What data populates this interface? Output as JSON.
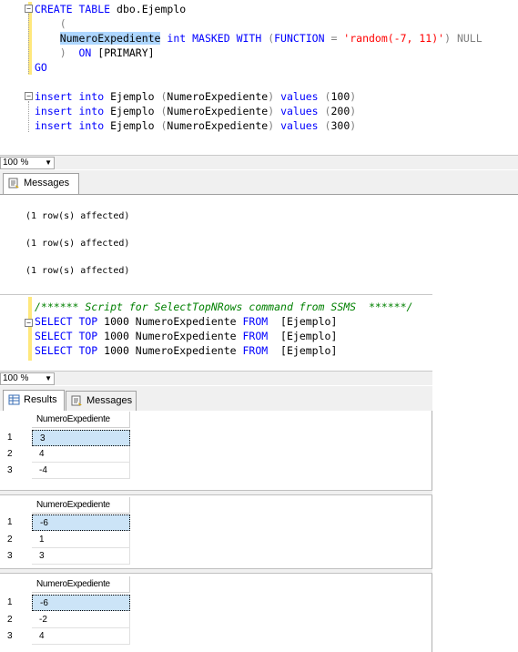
{
  "editor1": {
    "lines": [
      {
        "parts": [
          {
            "t": "CREATE TABLE",
            "c": "kw"
          },
          {
            "t": " dbo.Ejemplo",
            "c": "plain"
          }
        ]
      },
      {
        "parts": [
          {
            "t": "    (",
            "c": "gray"
          }
        ]
      },
      {
        "parts": [
          {
            "t": "    ",
            "c": "plain"
          },
          {
            "t": "NumeroExpediente",
            "c": "plain sel"
          },
          {
            "t": " int MASKED WITH ",
            "c": "kw"
          },
          {
            "t": "(",
            "c": "gray"
          },
          {
            "t": "FUNCTION",
            "c": "kw"
          },
          {
            "t": " = ",
            "c": "gray"
          },
          {
            "t": "'random(-7, 11)'",
            "c": "str"
          },
          {
            "t": ")",
            "c": "gray"
          },
          {
            "t": " NULL",
            "c": "gray"
          }
        ]
      },
      {
        "parts": [
          {
            "t": "    ",
            "c": "plain"
          },
          {
            "t": ")",
            "c": "gray"
          },
          {
            "t": "  ON ",
            "c": "kw"
          },
          {
            "t": "[PRIMARY]",
            "c": "plain"
          }
        ]
      },
      {
        "parts": [
          {
            "t": "GO",
            "c": "kw"
          }
        ]
      },
      {
        "parts": []
      },
      {
        "parts": [
          {
            "t": "insert into",
            "c": "kw"
          },
          {
            "t": " Ejemplo ",
            "c": "plain"
          },
          {
            "t": "(",
            "c": "gray"
          },
          {
            "t": "NumeroExpediente",
            "c": "plain"
          },
          {
            "t": ")",
            "c": "gray"
          },
          {
            "t": " values ",
            "c": "kw"
          },
          {
            "t": "(",
            "c": "gray"
          },
          {
            "t": "100",
            "c": "plain"
          },
          {
            "t": ")",
            "c": "gray"
          }
        ]
      },
      {
        "parts": [
          {
            "t": "insert into",
            "c": "kw"
          },
          {
            "t": " Ejemplo ",
            "c": "plain"
          },
          {
            "t": "(",
            "c": "gray"
          },
          {
            "t": "NumeroExpediente",
            "c": "plain"
          },
          {
            "t": ")",
            "c": "gray"
          },
          {
            "t": " values ",
            "c": "kw"
          },
          {
            "t": "(",
            "c": "gray"
          },
          {
            "t": "200",
            "c": "plain"
          },
          {
            "t": ")",
            "c": "gray"
          }
        ]
      },
      {
        "parts": [
          {
            "t": "insert into",
            "c": "kw"
          },
          {
            "t": " Ejemplo ",
            "c": "plain"
          },
          {
            "t": "(",
            "c": "gray"
          },
          {
            "t": "NumeroExpediente",
            "c": "plain"
          },
          {
            "t": ")",
            "c": "gray"
          },
          {
            "t": " values ",
            "c": "kw"
          },
          {
            "t": "(",
            "c": "gray"
          },
          {
            "t": "300",
            "c": "plain"
          },
          {
            "t": ")",
            "c": "gray"
          }
        ]
      }
    ]
  },
  "zoom1": {
    "value": "100 %"
  },
  "tabs1": {
    "messages_label": "Messages"
  },
  "messages1": [
    "(1 row(s) affected)",
    "(1 row(s) affected)",
    "(1 row(s) affected)"
  ],
  "editor2": {
    "lines": [
      {
        "parts": [
          {
            "t": "/****** Script for SelectTopNRows command from SSMS  ******/",
            "c": "cmt"
          }
        ]
      },
      {
        "parts": [
          {
            "t": "SELECT TOP",
            "c": "kw"
          },
          {
            "t": " 1000 NumeroExpediente ",
            "c": "plain"
          },
          {
            "t": "FROM",
            "c": "kw"
          },
          {
            "t": "  [Ejemplo]",
            "c": "plain"
          }
        ]
      },
      {
        "parts": [
          {
            "t": "SELECT TOP",
            "c": "kw"
          },
          {
            "t": " 1000 NumeroExpediente ",
            "c": "plain"
          },
          {
            "t": "FROM",
            "c": "kw"
          },
          {
            "t": "  [Ejemplo]",
            "c": "plain"
          }
        ]
      },
      {
        "parts": [
          {
            "t": "SELECT TOP",
            "c": "kw"
          },
          {
            "t": " 1000 NumeroExpediente ",
            "c": "plain"
          },
          {
            "t": "FROM",
            "c": "kw"
          },
          {
            "t": "  [Ejemplo]",
            "c": "plain"
          }
        ]
      }
    ]
  },
  "zoom2": {
    "value": "100 %"
  },
  "tabs2": {
    "results_label": "Results",
    "messages_label": "Messages"
  },
  "grids": [
    {
      "header": "NumeroExpediente",
      "rows": [
        {
          "n": "1",
          "v": "3"
        },
        {
          "n": "2",
          "v": "4"
        },
        {
          "n": "3",
          "v": "-4"
        }
      ]
    },
    {
      "header": "NumeroExpediente",
      "rows": [
        {
          "n": "1",
          "v": "-6"
        },
        {
          "n": "2",
          "v": "1"
        },
        {
          "n": "3",
          "v": "3"
        }
      ]
    },
    {
      "header": "NumeroExpediente",
      "rows": [
        {
          "n": "1",
          "v": "-6"
        },
        {
          "n": "2",
          "v": "-2"
        },
        {
          "n": "3",
          "v": "4"
        }
      ]
    }
  ]
}
